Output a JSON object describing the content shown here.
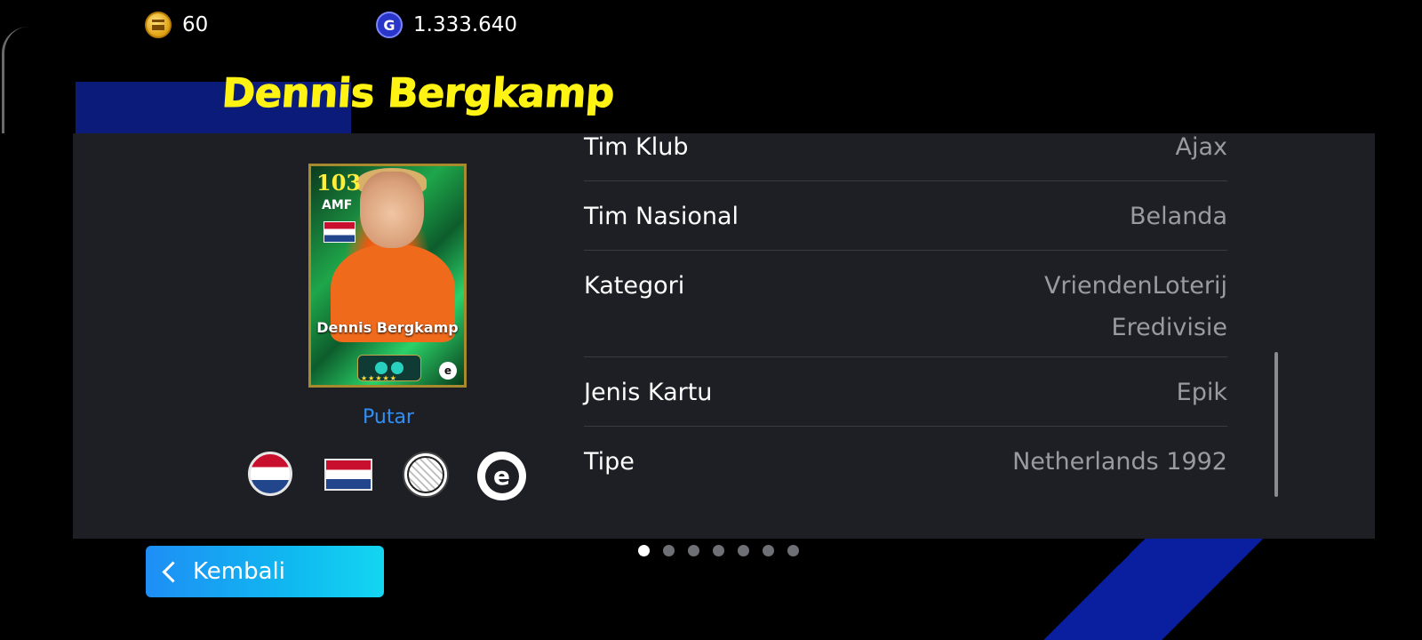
{
  "currency": {
    "coins": "60",
    "gp": "1.333.640"
  },
  "player": {
    "name": "Dennis Bergkamp"
  },
  "card": {
    "rating": "103",
    "position": "AMF",
    "name": "Dennis Bergkamp",
    "stars": "★★★★★"
  },
  "putar_label": "Putar",
  "details": [
    {
      "label": "Tim Klub",
      "value": "Ajax"
    },
    {
      "label": "Tim Nasional",
      "value": "Belanda"
    },
    {
      "label": "Kategori",
      "value": "VriendenLoterij Eredivisie"
    },
    {
      "label": "Jenis Kartu",
      "value": "Epik"
    },
    {
      "label": "Tipe",
      "value": "Netherlands 1992"
    }
  ],
  "back_label": "Kembali",
  "pagination": {
    "total": 7,
    "active": 1
  },
  "league_badge_letter": "e"
}
